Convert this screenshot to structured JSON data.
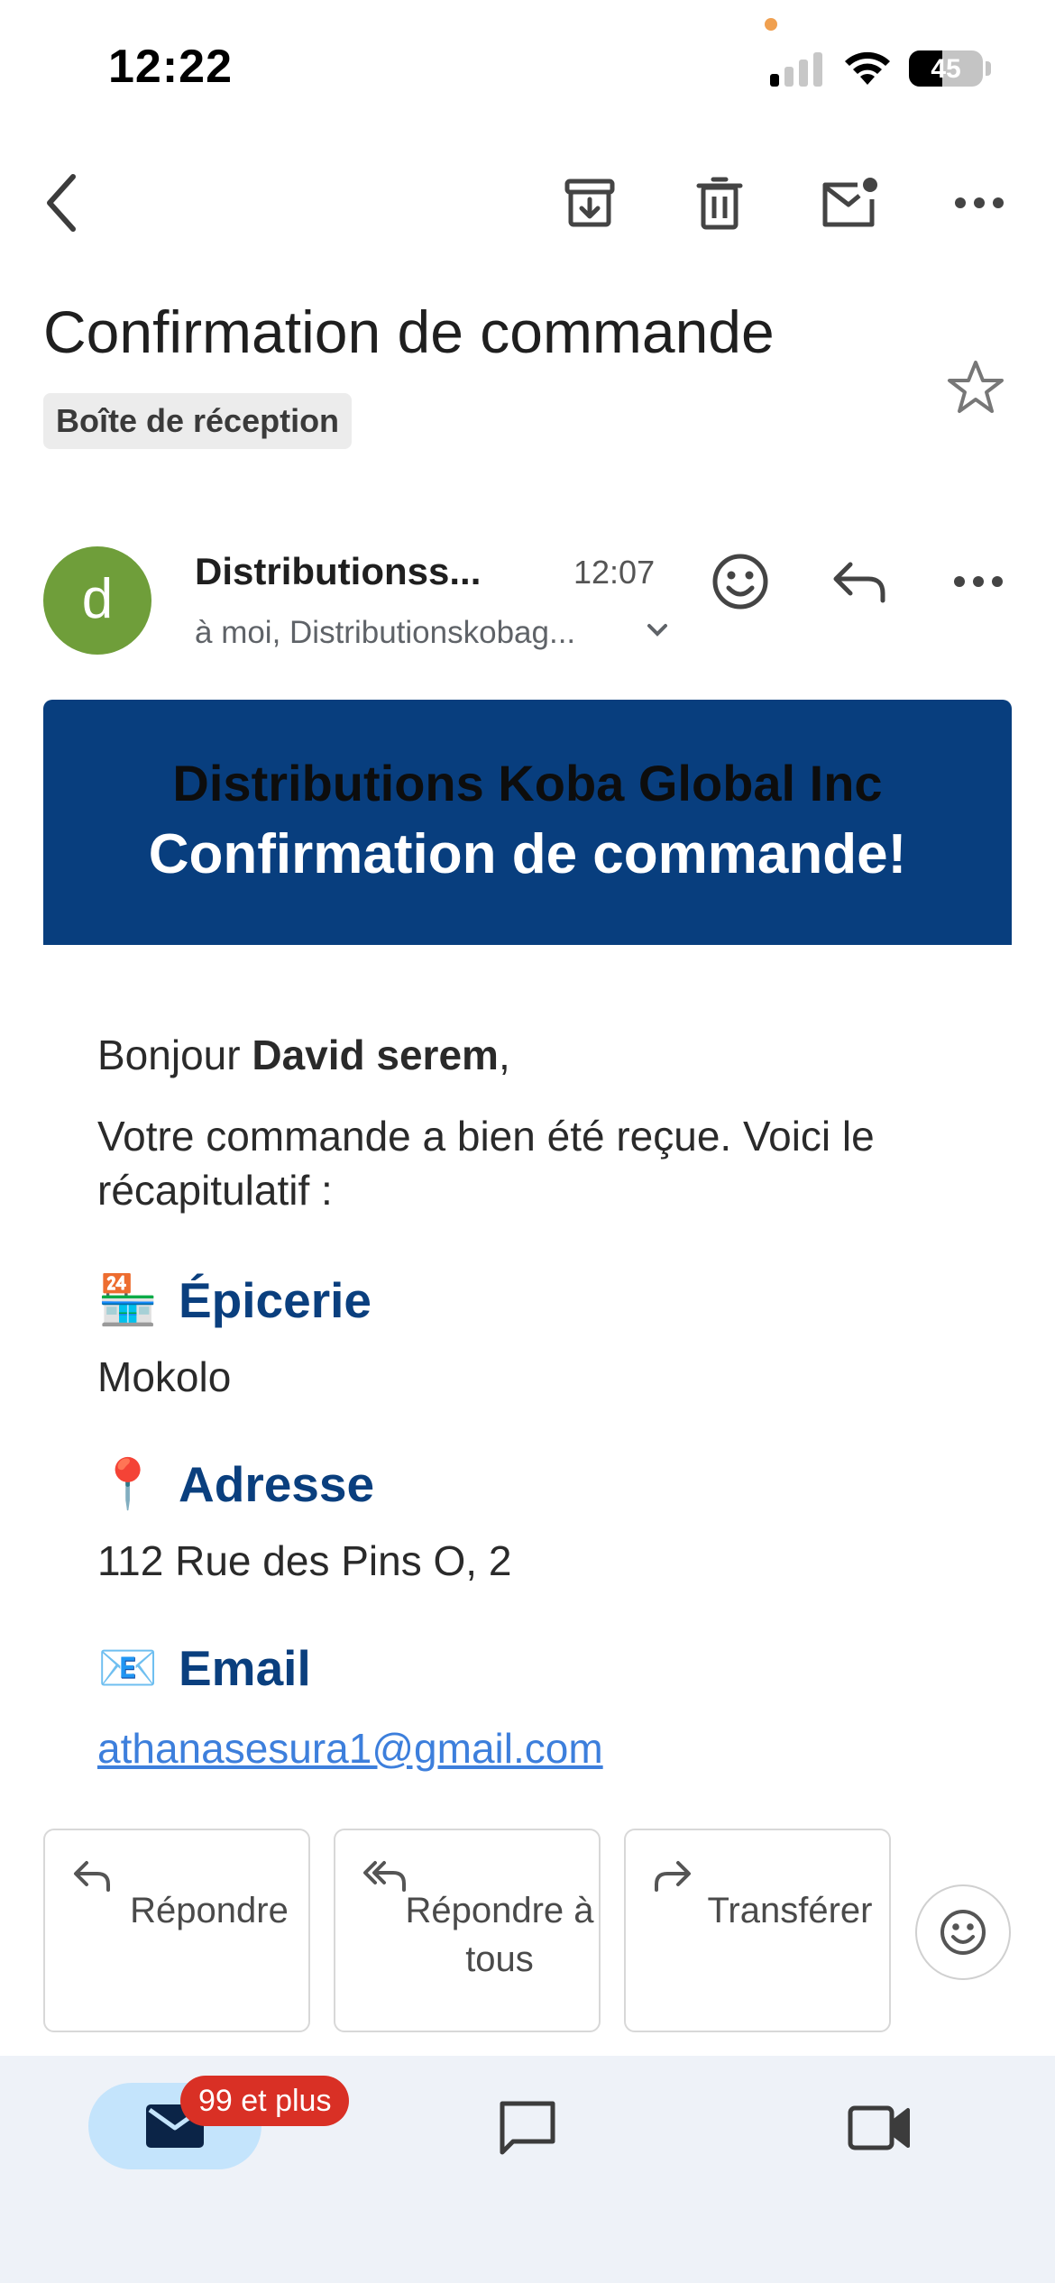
{
  "status_bar": {
    "time": "12:22",
    "battery": "45",
    "battery_level": 0.45
  },
  "toolbar": {
    "back_icon": "arrow-left-icon",
    "archive_icon": "archive-icon",
    "delete_icon": "trash-icon",
    "mark_unread_icon": "mark-unread-icon",
    "more_icon": "more-horizontal-icon"
  },
  "email": {
    "subject": "Confirmation de commande",
    "label": "Boîte de réception",
    "sender_initial": "d",
    "sender_name": "Distributionss...",
    "time": "12:07",
    "recipients": "à moi, Distributionskobag...",
    "avatar_color": "#6f9e3a"
  },
  "banner": {
    "company": "Distributions Koba Global Inc",
    "title": "Confirmation de commande!",
    "color": "#083e7e"
  },
  "body": {
    "greeting_prefix": "Bonjour ",
    "greeting_name": "David serem",
    "greeting_suffix": ",",
    "intro": "Votre commande a bien été reçue. Voici le récapitulatif :",
    "sections": [
      {
        "icon": "🏪",
        "title": "Épicerie",
        "value": "Mokolo"
      },
      {
        "icon": "📍",
        "title": "Adresse",
        "value": "112 Rue des Pins O, 2"
      },
      {
        "icon": "📧",
        "title": "Email",
        "value": "athanasesura1@gmail.com"
      }
    ]
  },
  "actions": {
    "reply": "Répondre",
    "reply_all": "Répondre à tous",
    "forward": "Transférer"
  },
  "bottom_nav": {
    "mail_badge": "99 et plus",
    "mail_icon": "mail-icon",
    "chat_icon": "chat-icon",
    "meet_icon": "video-icon"
  },
  "colors": {
    "accent_blue": "#0a3f7e",
    "link": "#3d7fdc",
    "badge": "#d93025",
    "nav_bg": "#eef2f8"
  }
}
